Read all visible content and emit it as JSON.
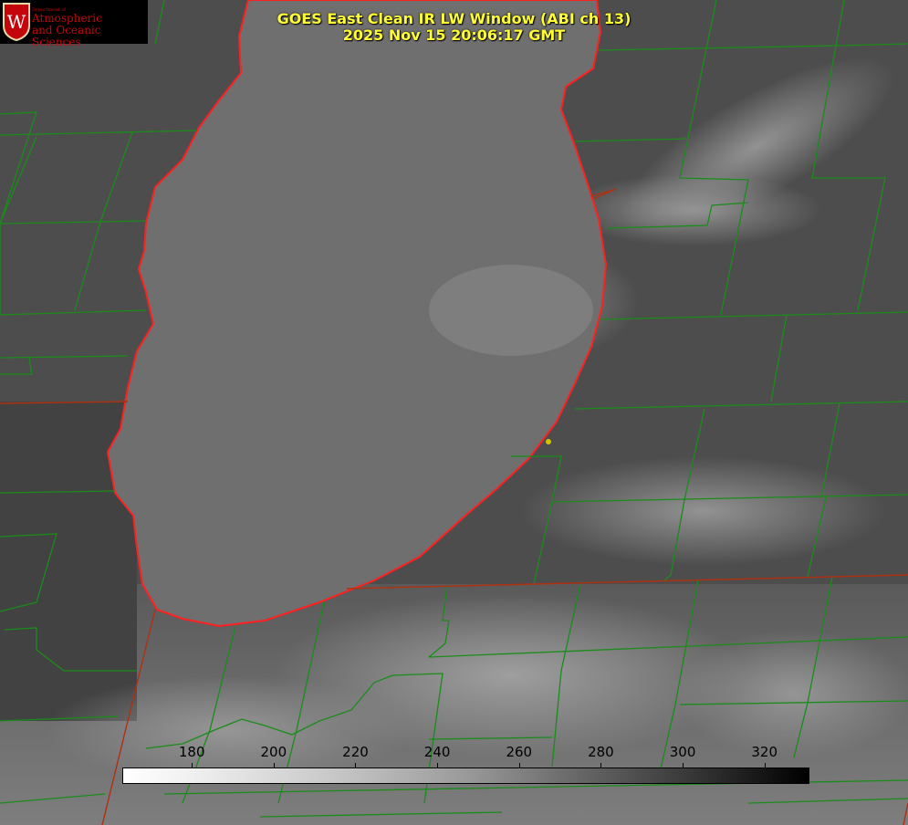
{
  "title": {
    "line1": "GOES East Clean IR LW Window (ABI ch 13)",
    "line2": "2025 Nov 15 20:06:17 GMT"
  },
  "logo": {
    "department": "Department of",
    "line1": "Atmospheric",
    "line2": "and Oceanic Sciences",
    "shield_letter": "W"
  },
  "colorbar": {
    "ticks": [
      "180",
      "200",
      "220",
      "240",
      "260",
      "280",
      "300",
      "320"
    ],
    "range": [
      163,
      331
    ],
    "gradient": "white-to-black"
  },
  "colors": {
    "title": "#ffff33",
    "county_lines": "#1a8c1a",
    "state_lines": "#b03010",
    "coastline": "#ff2020",
    "marker": "#d4c400",
    "lake": "#727272",
    "land": "#4c4c4c"
  }
}
